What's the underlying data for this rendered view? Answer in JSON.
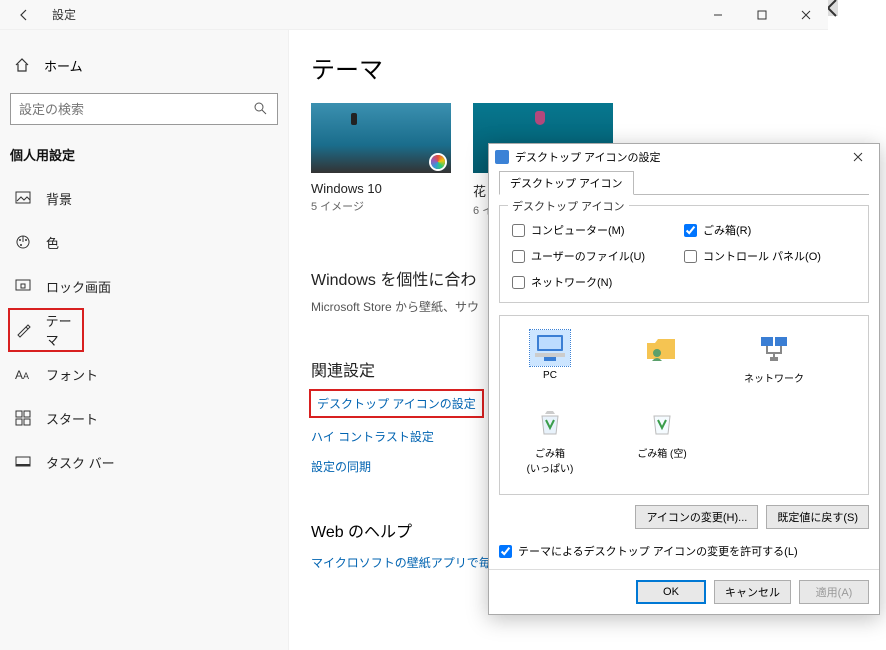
{
  "window": {
    "title": "設定",
    "home": "ホーム",
    "search_placeholder": "設定の検索",
    "category": "個人用設定"
  },
  "nav": [
    {
      "icon": "background-icon",
      "label": "背景"
    },
    {
      "icon": "colors-icon",
      "label": "色"
    },
    {
      "icon": "lockscreen-icon",
      "label": "ロック画面"
    },
    {
      "icon": "themes-icon",
      "label": "テーマ"
    },
    {
      "icon": "fonts-icon",
      "label": "フォント"
    },
    {
      "icon": "start-icon",
      "label": "スタート"
    },
    {
      "icon": "taskbar-icon",
      "label": "タスク バー"
    }
  ],
  "page": {
    "heading": "テーマ",
    "themes": [
      {
        "name": "Windows 10",
        "count": "5 イメージ"
      },
      {
        "name": "花",
        "count": "6 イ"
      }
    ],
    "personalize_heading": "Windows を個性に合わ",
    "personalize_sub": "Microsoft Store から壁紙、サウ",
    "related_heading": "関連設定",
    "links": {
      "desktop_icons": "デスクトップ アイコンの設定",
      "high_contrast": "ハイ コントラスト設定",
      "sync": "設定の同期"
    },
    "web_heading": "Web のヘルプ",
    "web_link": "マイクロソフトの壁紙アプリで毎日"
  },
  "dialog": {
    "title": "デスクトップ アイコンの設定",
    "tab": "デスクトップ アイコン",
    "group_label": "デスクトップ アイコン",
    "checks": {
      "computer": "コンピューター(M)",
      "recycle": "ごみ箱(R)",
      "user_files": "ユーザーのファイル(U)",
      "control_panel": "コントロール パネル(O)",
      "network": "ネットワーク(N)"
    },
    "icons": {
      "pc": "PC",
      "user": "",
      "network": "ネットワーク",
      "recycle_full": "ごみ箱\n(いっぱい)",
      "recycle_empty": "ごみ箱 (空)"
    },
    "change_icon": "アイコンの変更(H)...",
    "restore_default": "既定値に戻す(S)",
    "allow_themes": "テーマによるデスクトップ アイコンの変更を許可する(L)",
    "ok": "OK",
    "cancel": "キャンセル",
    "apply": "適用(A)"
  }
}
